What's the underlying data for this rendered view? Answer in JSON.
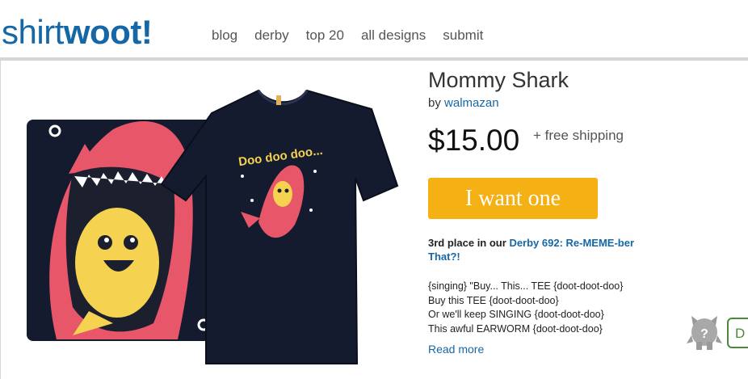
{
  "header": {
    "logo_part1": "shirt",
    "logo_part2": "woot!",
    "nav": [
      "blog",
      "derby",
      "top 20",
      "all designs",
      "submit"
    ]
  },
  "product": {
    "title": "Mommy Shark",
    "by_label": "by",
    "artist": "walmazan",
    "price": "$15.00",
    "shipping": "+ free shipping",
    "buy_label": "I want one",
    "derby_prefix": "3rd place in our",
    "derby_link": "Derby 692: Re-MEME-ber That?!",
    "description": [
      "{singing} \"Buy... This... TEE {doot-doot-doo}",
      "Buy this TEE {doot-doot-doo}",
      "Or we'll keep SINGING {doot-doot-doo}",
      "This awful EARWORM {doot-doot-doo}"
    ],
    "read_more": "Read more",
    "shirt_art_text": "Doo doo doo..."
  },
  "chat": {
    "label": "D"
  },
  "colors": {
    "brand_blue": "#1667a6",
    "buy_yellow": "#f5b014",
    "shirt_navy": "#141b2e",
    "shark_pink": "#e8566a",
    "fish_yellow": "#f5d350"
  }
}
